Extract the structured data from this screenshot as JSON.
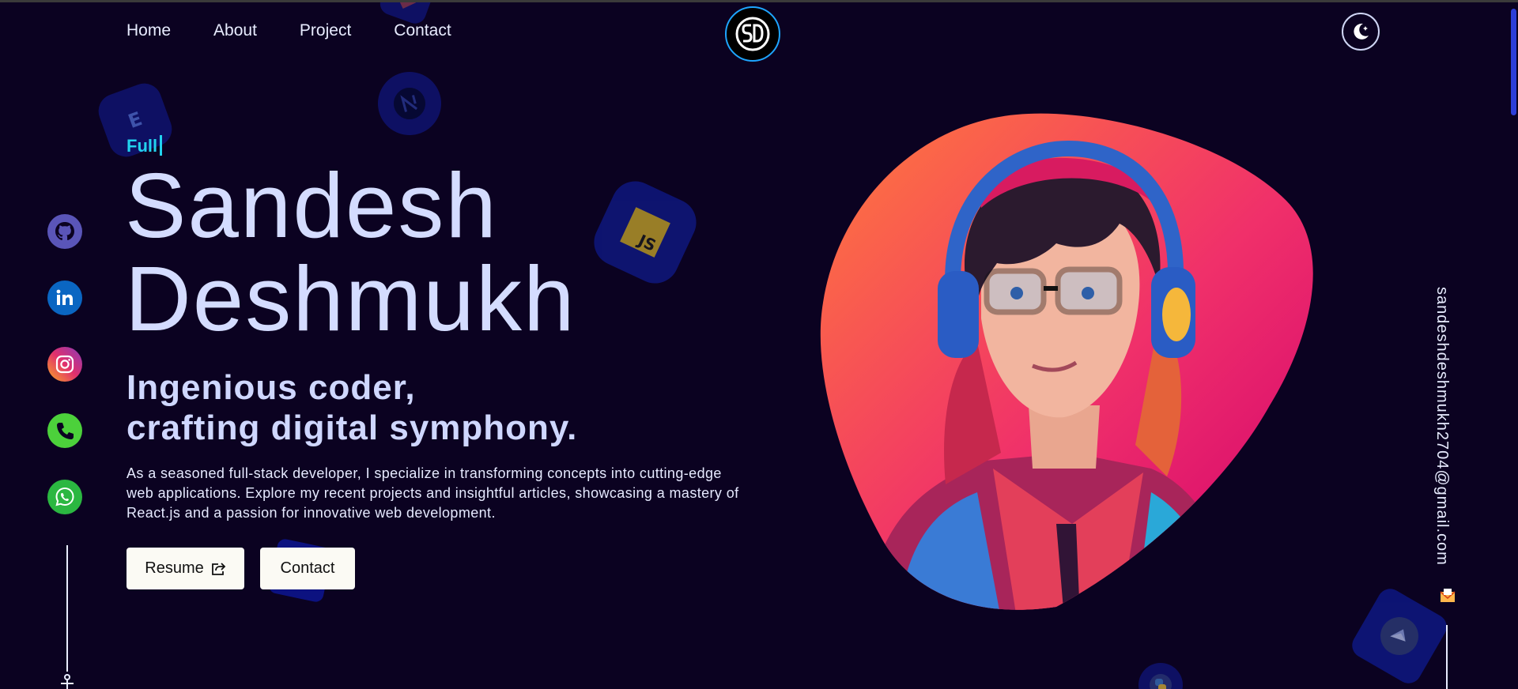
{
  "nav": {
    "items": [
      "Home",
      "About",
      "Project",
      "Contact"
    ]
  },
  "logo": {
    "text": "SD"
  },
  "hero": {
    "typed_text": "Full",
    "first_name": "Sandesh",
    "last_name": "Deshmukh",
    "tagline_line1": "Ingenious coder,",
    "tagline_line2": "crafting digital symphony.",
    "description": "As a seasoned full-stack developer, I specialize in transforming concepts into cutting-edge web applications. Explore my recent projects and insightful articles, showcasing a mastery of React.js and a passion for innovative web development."
  },
  "buttons": {
    "resume_label": "Resume",
    "contact_label": "Contact"
  },
  "social": [
    "github-icon",
    "linkedin-icon",
    "instagram-icon",
    "phone-icon",
    "whatsapp-icon"
  ],
  "email": "sandeshdeshmukh2704@gmail.com",
  "colors": {
    "background": "#0b0221",
    "accent_cyan": "#22d3ee",
    "heading": "#d4dcff",
    "blob_start": "#ff7a3c",
    "blob_end": "#d1006f"
  }
}
